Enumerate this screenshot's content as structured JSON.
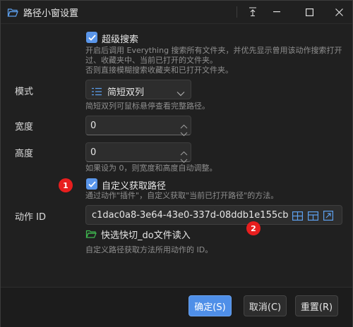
{
  "window": {
    "title": "路径小窗设置"
  },
  "super_search": {
    "label": "超级搜索",
    "checked": true,
    "hint_lines": [
      "开启后调用 Everything 搜索所有文件夹，并优先显示曾用该动作搜索打开",
      "过、收藏夹中、当前已打开的文件夹。",
      "否则直接模糊搜索收藏夹和已打开文件夹。"
    ]
  },
  "mode": {
    "label": "模式",
    "value": "简短双列",
    "hint": "简短双列可鼠标悬停查看完整路径。"
  },
  "width": {
    "label": "宽度",
    "value": "0"
  },
  "height": {
    "label": "高度",
    "value": "0",
    "hint": "如果设为 0，则宽度和高度自动调整。"
  },
  "custom_path": {
    "label": "自定义获取路径",
    "checked": true,
    "hint": "通过动作\"插件\"，自定义获取\"当前已打开路径\"的方法。"
  },
  "action_id": {
    "label": "动作 ID",
    "value": "c1dac0a8-3e64-43e0-337d-08ddb1e155cb",
    "link_text": "快选快切_do文件读入",
    "hint": "自定义路径获取方法所用动作的 ID。"
  },
  "badges": {
    "one": "1",
    "two": "2"
  },
  "buttons": {
    "ok": "确定(S)",
    "cancel": "取消(C)",
    "reset": "重置(R)"
  },
  "colors": {
    "accent": "#4f8fe8",
    "badge": "#e81e1e",
    "folder": "#3fb950"
  }
}
